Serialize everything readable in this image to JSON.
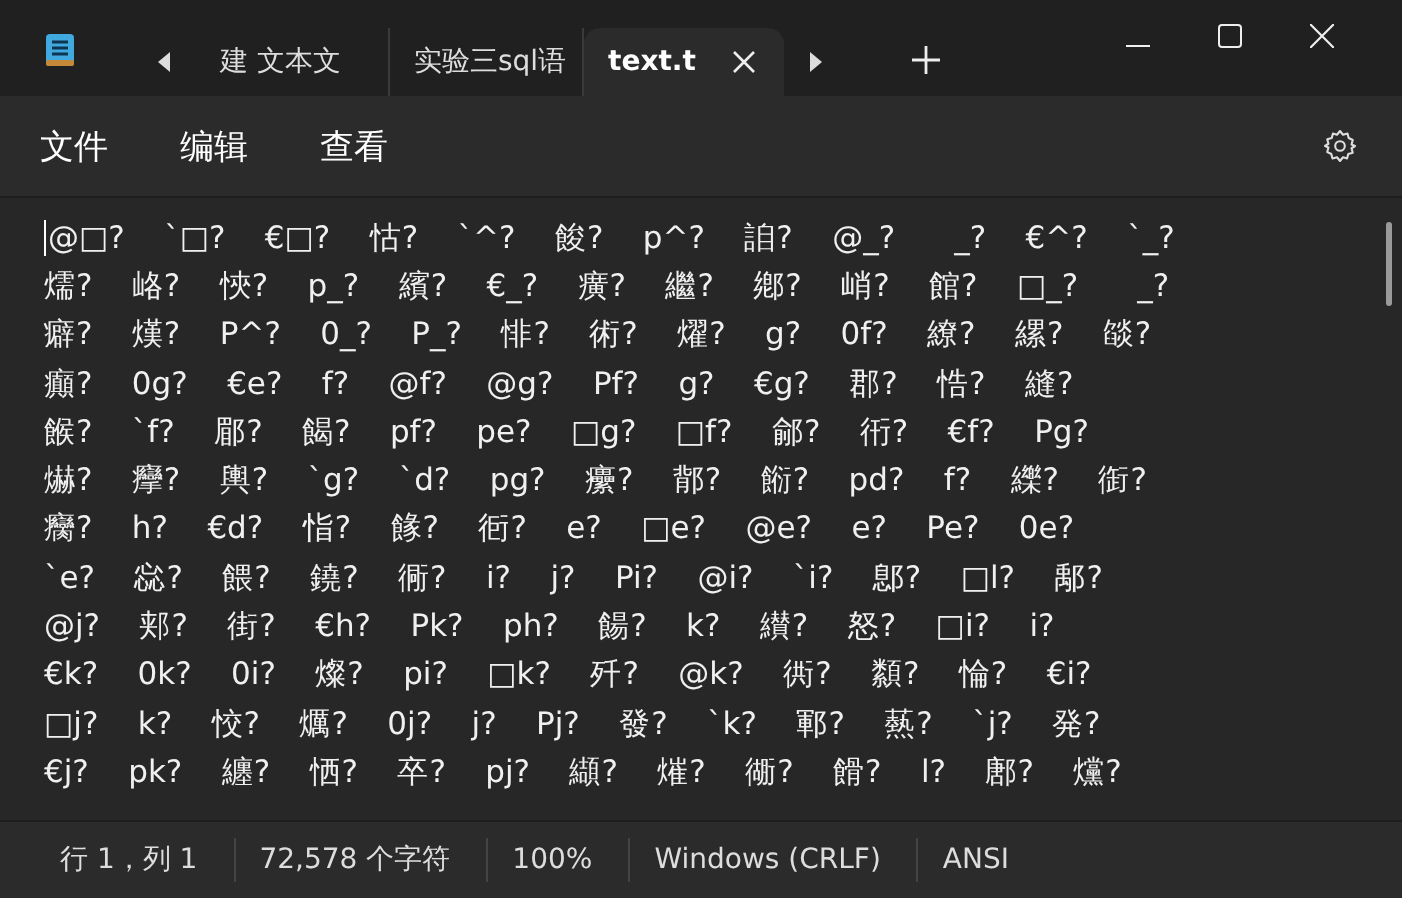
{
  "tabs": [
    {
      "label": "建 文本文",
      "selected": false
    },
    {
      "label": "实验三sql语",
      "selected": false
    },
    {
      "label": "text.t",
      "selected": true
    }
  ],
  "menu": [
    "文件",
    "编辑",
    "查看"
  ],
  "document": {
    "lines": [
      "@□?    `□?    €□?    怙?    `^?    餕?    p^?    詯?    @_?      _?    €^?    `_?",
      "燸?    峈?    悏?    p_?    繽?    €_?    癀?    繼?    鄕?    峭?    館?    □_?      _?",
      "癖?    熯?    P^?    0_?    P_?    悱?    術?    燿?    g?    0f?    繚?    縲?    燄?",
      "癲?    0g?    €e?    f?    @f?    @g?    Pf?    g?    €g?    郡?    悎?    縫?",
      "餱?    `f?    郿?    餲?    pf?    pe?    □g?    □f?    鄃?    衎?    €f?    Pg?",
      "爀?    癴?    輿?    `g?    `d?    pg?    癳?    鄁?    餰?    pd?    f?    纅?    衘?",
      "癵?    h?    €d?    恉?    餯?    衐?    e?    □e?    @e?    e?    Pe?    0e?",
      "`e?    惢?    餵?    鐃?    衕?    i?    j?    Pi?    @i?    `i?    鄎?    □l?    鄅?",
      "@j?    郏?    街?    €h?    Pk?    ph?    餳?    k?    纉?    怒?    □i?    i?",
      "€k?    0k?    0i?    燦?    pi?    □k?    歼?    @k?    衖?    纇?    惀?    €i?",
      "□j?    k?    恔?    爄?    0j?    j?    Pj?    發?    `k?    鄆?    爇?    `j?    発?",
      "€j?    pk?    纏?    恓?    卒?    pj?    纈?    熣?    衚?    餶?    l?    鄌?    爣?"
    ]
  },
  "status_bar": [
    "行 1，列 1",
    "72,578 个字符",
    "100%",
    "Windows (CRLF)",
    "ANSI"
  ]
}
